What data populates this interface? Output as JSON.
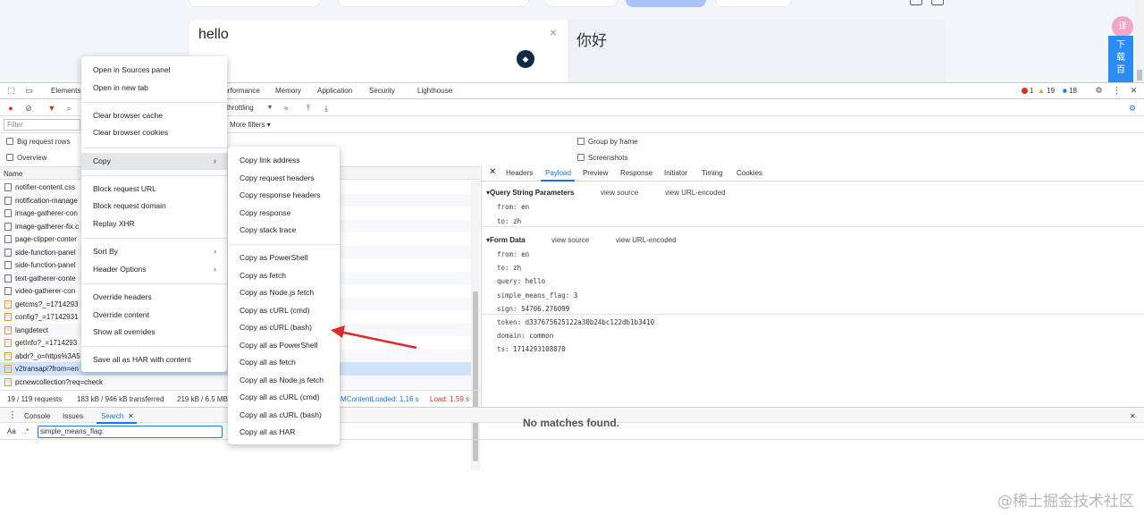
{
  "page": {
    "source_text": "hello",
    "target_text": "你好",
    "clear_icon": "×",
    "fanyi_badge": "ⓧ",
    "download_label": "下\n载\n百"
  },
  "devtools": {
    "tabs": [
      "Elements",
      "Performance",
      "Memory",
      "Application",
      "Security",
      "Lighthouse"
    ],
    "errors": "1",
    "warnings": "19",
    "issues": "18",
    "throttling": "throttling",
    "more_filters": "More filters",
    "filter_placeholder": "Filter",
    "options": {
      "big_rows": "Big request rows",
      "overview": "Overview",
      "group_by_frame": "Group by frame",
      "screenshots": "Screenshots"
    },
    "name_header": "Name",
    "requests": [
      {
        "name": "notifier-content.css",
        "type": "doc"
      },
      {
        "name": "notification-manage",
        "type": "doc"
      },
      {
        "name": "image-gatherer-con",
        "type": "doc"
      },
      {
        "name": "image-gatherer-fix.c",
        "type": "doc"
      },
      {
        "name": "page-clipper-conter",
        "type": "doc"
      },
      {
        "name": "side-function-panel",
        "type": "doc"
      },
      {
        "name": "side-function-panel",
        "type": "doc"
      },
      {
        "name": "text-gatherer-conte",
        "type": "doc"
      },
      {
        "name": "video-gatherer-con",
        "type": "doc"
      },
      {
        "name": "getcms?_=1714293",
        "type": "xhr"
      },
      {
        "name": "config?_=17142931",
        "type": "xhr"
      },
      {
        "name": "langdetect",
        "type": "xhr"
      },
      {
        "name": "getInfo?_=1714293",
        "type": "xhr"
      },
      {
        "name": "abdr?_o=https%3A5",
        "type": "xhr"
      },
      {
        "name": "v2transapi?from=en",
        "type": "xhr"
      },
      {
        "name": "pcnewcollection?req=check",
        "type": "xhr"
      }
    ],
    "status": {
      "requests": "19 / 119 requests",
      "transferred": "183 kB / 946 kB transferred",
      "resources": "219 kB / 6.5 MB",
      "dom_loaded": "MContentLoaded: 1.16 s",
      "load": "Load: 1.59 s"
    },
    "detail_tabs": [
      "Headers",
      "Payload",
      "Preview",
      "Response",
      "Initiator",
      "Timing",
      "Cookies"
    ],
    "query_section": {
      "title": "Query String Parameters",
      "view_source": "view source",
      "view_encoded": "view URL-encoded",
      "params": [
        {
          "key": "from:",
          "value": "en"
        },
        {
          "key": "to:",
          "value": "zh"
        }
      ]
    },
    "form_section": {
      "title": "Form Data",
      "view_source": "view source",
      "view_encoded": "view URL-encoded",
      "params": [
        {
          "key": "from:",
          "value": "en"
        },
        {
          "key": "to:",
          "value": "zh"
        },
        {
          "key": "query:",
          "value": "hello"
        },
        {
          "key": "simple_means_flag:",
          "value": "3"
        },
        {
          "key": "sign:",
          "value": "54706.276099"
        },
        {
          "key": "token:",
          "value": "d337675625122a30b24bc122db1b3410"
        },
        {
          "key": "domain:",
          "value": "common"
        },
        {
          "key": "ts:",
          "value": "1714293108870"
        }
      ]
    },
    "drawer": {
      "tabs": [
        "Console",
        "Issues",
        "Search"
      ],
      "search_value": "simple_means_flag:",
      "aa": "Aa",
      "regex": ".*",
      "no_matches": "No matches found."
    }
  },
  "context_menu": {
    "groups": [
      [
        "Open in Sources panel",
        "Open in new tab"
      ],
      [
        "Clear browser cache",
        "Clear browser cookies"
      ],
      [
        "Copy"
      ],
      [
        "Block request URL",
        "Block request domain",
        "Replay XHR"
      ],
      [
        "Sort By",
        "Header Options"
      ],
      [
        "Override headers",
        "Override content",
        "Show all overrides"
      ],
      [
        "Save all as HAR with content"
      ]
    ],
    "copy_submenu": {
      "groups": [
        [
          "Copy link address",
          "Copy request headers",
          "Copy response headers",
          "Copy response",
          "Copy stack trace"
        ],
        [
          "Copy as PowerShell",
          "Copy as fetch",
          "Copy as Node.js fetch",
          "Copy as cURL (cmd)",
          "Copy as cURL (bash)",
          "Copy all as PowerShell",
          "Copy all as fetch",
          "Copy all as Node.js fetch",
          "Copy all as cURL (cmd)",
          "Copy all as cURL (bash)",
          "Copy all as HAR"
        ]
      ]
    }
  },
  "watermark": "@稀土掘金技术社区",
  "colors": {
    "accent": "#1a73e8",
    "error": "#d93025",
    "warning": "#f29900",
    "issue": "#1a73e8",
    "arrow": "#e02828"
  }
}
